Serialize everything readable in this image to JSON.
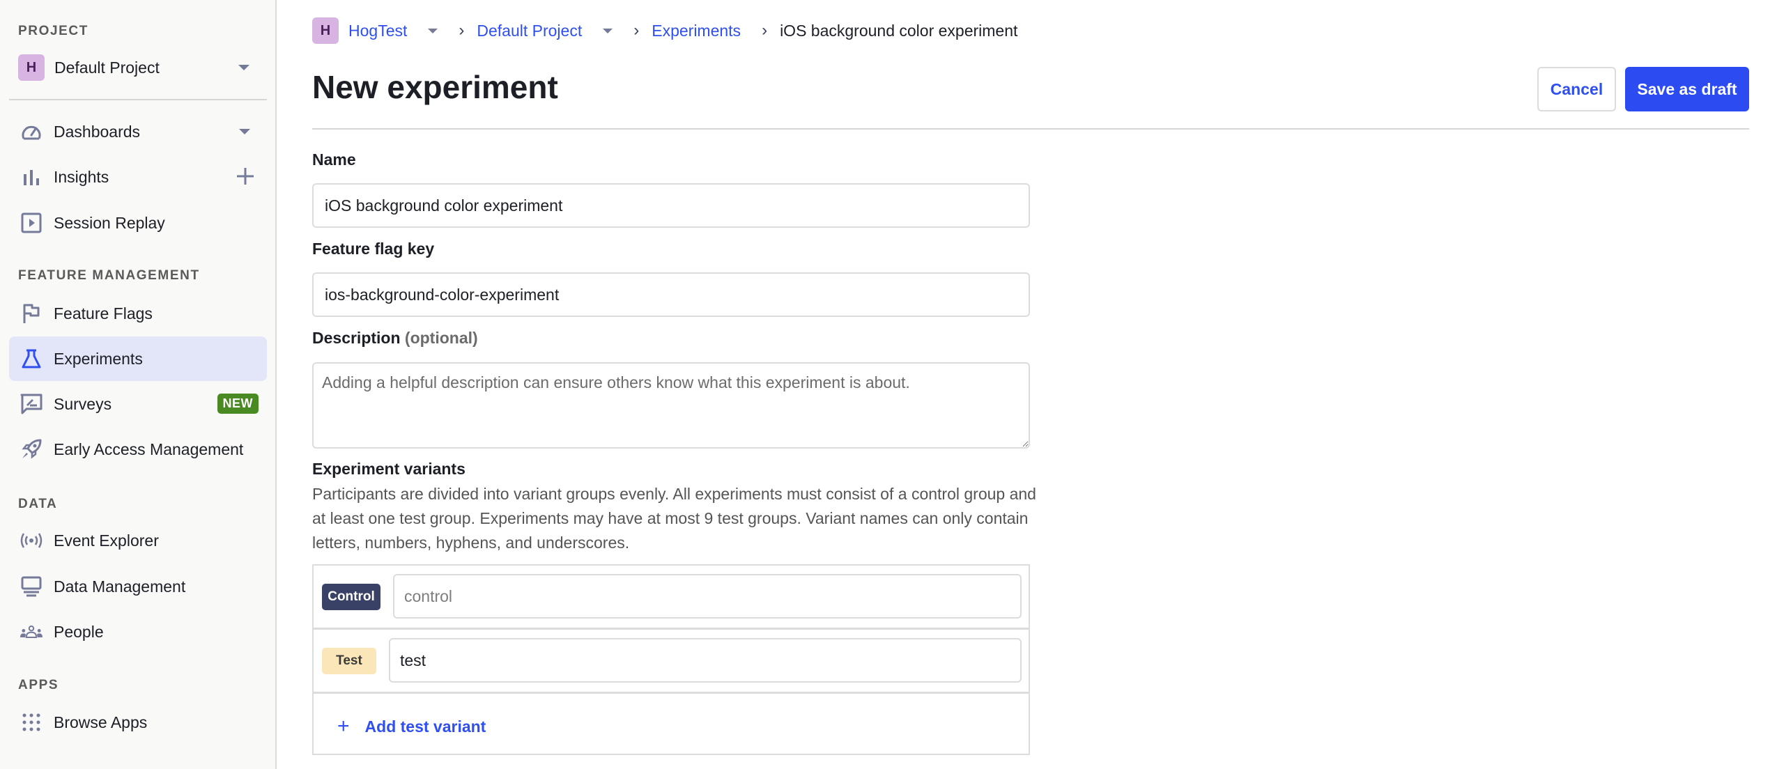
{
  "sidebar": {
    "project_section_title": "PROJECT",
    "project": {
      "avatar_letter": "H",
      "name": "Default Project"
    },
    "nav_top": [
      {
        "label": "Dashboards",
        "icon": "gauge-icon",
        "extra": "chevron-down"
      },
      {
        "label": "Insights",
        "icon": "bar-chart-icon",
        "extra": "plus"
      },
      {
        "label": "Session Replay",
        "icon": "play-square-icon"
      }
    ],
    "feature_section_title": "FEATURE MANAGEMENT",
    "nav_feature": [
      {
        "label": "Feature Flags",
        "icon": "flag-icon"
      },
      {
        "label": "Experiments",
        "icon": "flask-icon",
        "active": true
      },
      {
        "label": "Surveys",
        "icon": "survey-icon",
        "badge": "NEW"
      },
      {
        "label": "Early Access Management",
        "icon": "rocket-icon"
      }
    ],
    "data_section_title": "DATA",
    "nav_data": [
      {
        "label": "Event Explorer",
        "icon": "broadcast-icon"
      },
      {
        "label": "Data Management",
        "icon": "monitor-icon"
      },
      {
        "label": "People",
        "icon": "people-icon"
      }
    ],
    "apps_section_title": "APPS",
    "nav_apps": [
      {
        "label": "Browse Apps",
        "icon": "grid-dots-icon"
      }
    ]
  },
  "breadcrumb": {
    "avatar_letter": "H",
    "org": "HogTest",
    "project": "Default Project",
    "section": "Experiments",
    "current": "iOS background color experiment"
  },
  "header": {
    "title": "New experiment",
    "cancel_label": "Cancel",
    "save_label": "Save as draft"
  },
  "form": {
    "name_label": "Name",
    "name_value": "iOS background color experiment",
    "flag_key_label": "Feature flag key",
    "flag_key_value": "ios-background-color-experiment",
    "description_label": "Description",
    "description_optional": "(optional)",
    "description_placeholder": "Adding a helpful description can ensure others know what this experiment is about.",
    "description_value": "",
    "variants_label": "Experiment variants",
    "variants_help": "Participants are divided into variant groups evenly. All experiments must consist of a control group and at least one test group. Experiments may have at most 9 test groups. Variant names can only contain letters, numbers, hyphens, and underscores.",
    "variants": [
      {
        "tag": "Control",
        "value": "",
        "placeholder": "control"
      },
      {
        "tag": "Test",
        "value": "test",
        "placeholder": ""
      }
    ],
    "add_variant_label": "Add test variant"
  },
  "colors": {
    "accent": "#2c4cf2",
    "active_nav_bg": "#e3e6f8",
    "new_badge": "#4a8a22",
    "control_tag": "#394166",
    "test_tag": "#fae6b8",
    "avatar_bg": "#d8b4e2"
  }
}
